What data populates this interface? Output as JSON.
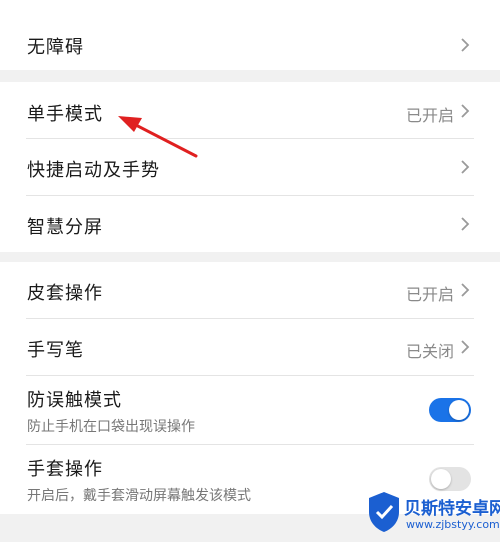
{
  "groups": [
    {
      "rows": [
        {
          "title": "无障碍",
          "value": "",
          "control": "chevron"
        }
      ]
    },
    {
      "rows": [
        {
          "title": "单手模式",
          "value": "已开启",
          "control": "chevron"
        },
        {
          "title": "快捷启动及手势",
          "value": "",
          "control": "chevron"
        },
        {
          "title": "智慧分屏",
          "value": "",
          "control": "chevron"
        }
      ]
    },
    {
      "rows": [
        {
          "title": "皮套操作",
          "value": "已开启",
          "control": "chevron"
        },
        {
          "title": "手写笔",
          "value": "已关闭",
          "control": "chevron"
        },
        {
          "title": "防误触模式",
          "subtitle": "防止手机在口袋出现误操作",
          "control": "toggle",
          "toggle_on": true
        },
        {
          "title": "手套操作",
          "subtitle": "开启后，戴手套滑动屏幕触发该模式",
          "control": "toggle",
          "toggle_on": false
        }
      ]
    }
  ],
  "colors": {
    "accent": "#1a73e8",
    "annotation_arrow": "#e02020"
  },
  "watermark": {
    "text": "贝斯特安卓网",
    "url": "www.zjbstyy.com"
  }
}
